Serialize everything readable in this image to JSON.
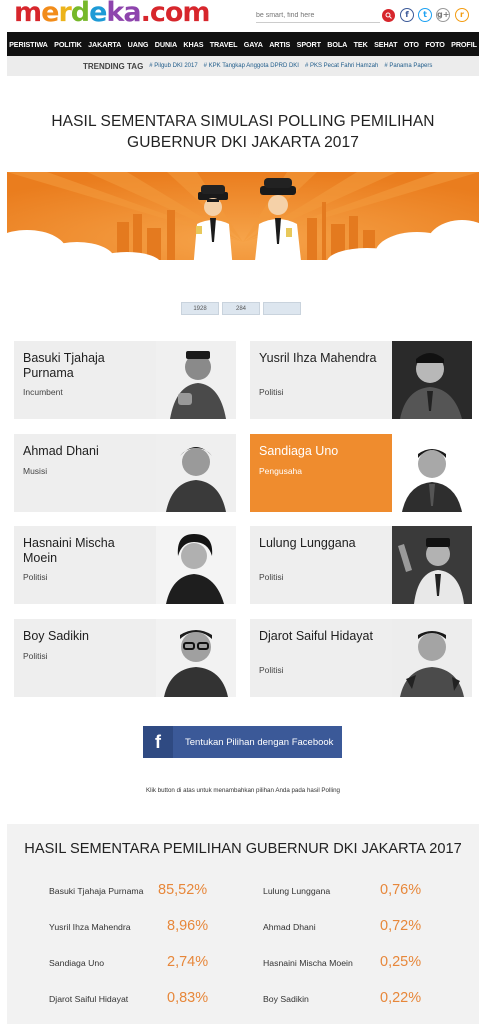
{
  "header": {
    "logo": {
      "part1": "m",
      "part2": "e",
      "part3": "r",
      "part4": "d",
      "part5": "e",
      "part6": "ka",
      "part7": ".com"
    },
    "search_placeholder": "be smart, find here",
    "social": {
      "facebook": "f",
      "twitter": "t",
      "googleplus": "g+",
      "rss": "r"
    }
  },
  "nav": {
    "items": [
      "PERISTIWA",
      "POLITIK",
      "JAKARTA",
      "UANG",
      "DUNIA",
      "KHAS",
      "TRAVEL",
      "GAYA",
      "ARTIS",
      "SPORT",
      "BOLA",
      "TEK",
      "SEHAT",
      "OTO",
      "FOTO",
      "PROFIL"
    ]
  },
  "trending": {
    "label": "TRENDING TAG",
    "tags": [
      "# Pilgub DKI 2017",
      "# KPK Tangkap Anggota DPRD DKI",
      "# PKS Pecat Fahri Hamzah",
      "# Panama Papers"
    ]
  },
  "page_title": "HASIL SEMENTARA SIMULASI POLLING PEMILIHAN GUBERNUR DKI JAKARTA 2017",
  "counters": [
    "1928",
    "284",
    ""
  ],
  "candidates": [
    {
      "name": "Basuki Tjahaja Purnama",
      "role": "Incumbent",
      "selected": false
    },
    {
      "name": "Yusril Ihza Mahendra",
      "role": "Politisi",
      "selected": false
    },
    {
      "name": "Ahmad Dhani",
      "role": "Musisi",
      "selected": false
    },
    {
      "name": "Sandiaga Uno",
      "role": "Pengusaha",
      "selected": true
    },
    {
      "name": "Hasnaini Mischa Moein",
      "role": "Politisi",
      "selected": false
    },
    {
      "name": "Lulung Lunggana",
      "role": "Politisi",
      "selected": false
    },
    {
      "name": "Boy Sadikin",
      "role": "Politisi",
      "selected": false
    },
    {
      "name": "Djarot Saiful Hidayat",
      "role": "Politisi",
      "selected": false
    }
  ],
  "facebook_button": {
    "icon": "f",
    "label": "Tentukan Pilihan dengan Facebook"
  },
  "facebook_note": "Klik button di atas untuk menambahkan pilihan Anda pada hasil Polling",
  "results": {
    "title": "HASIL SEMENTARA PEMILIHAN GUBERNUR DKI JAKARTA 2017",
    "left": [
      {
        "name": "Basuki Tjahaja Purnama",
        "percent": "85,52%"
      },
      {
        "name": "Yusril Ihza Mahendra",
        "percent": "8,96%"
      },
      {
        "name": "Sandiaga Uno",
        "percent": "2,74%"
      },
      {
        "name": "Djarot Saiful Hidayat",
        "percent": "0,83%"
      }
    ],
    "right": [
      {
        "name": "Lulung Lunggana",
        "percent": "0,76%"
      },
      {
        "name": "Ahmad Dhani",
        "percent": "0,72%"
      },
      {
        "name": "Hasnaini Mischa Moein",
        "percent": "0,25%"
      },
      {
        "name": "Boy Sadikin",
        "percent": "0,22%"
      }
    ]
  },
  "colors": {
    "accent": "#ef8c2e",
    "facebook": "#3b5998",
    "nav_bg": "#111111"
  }
}
